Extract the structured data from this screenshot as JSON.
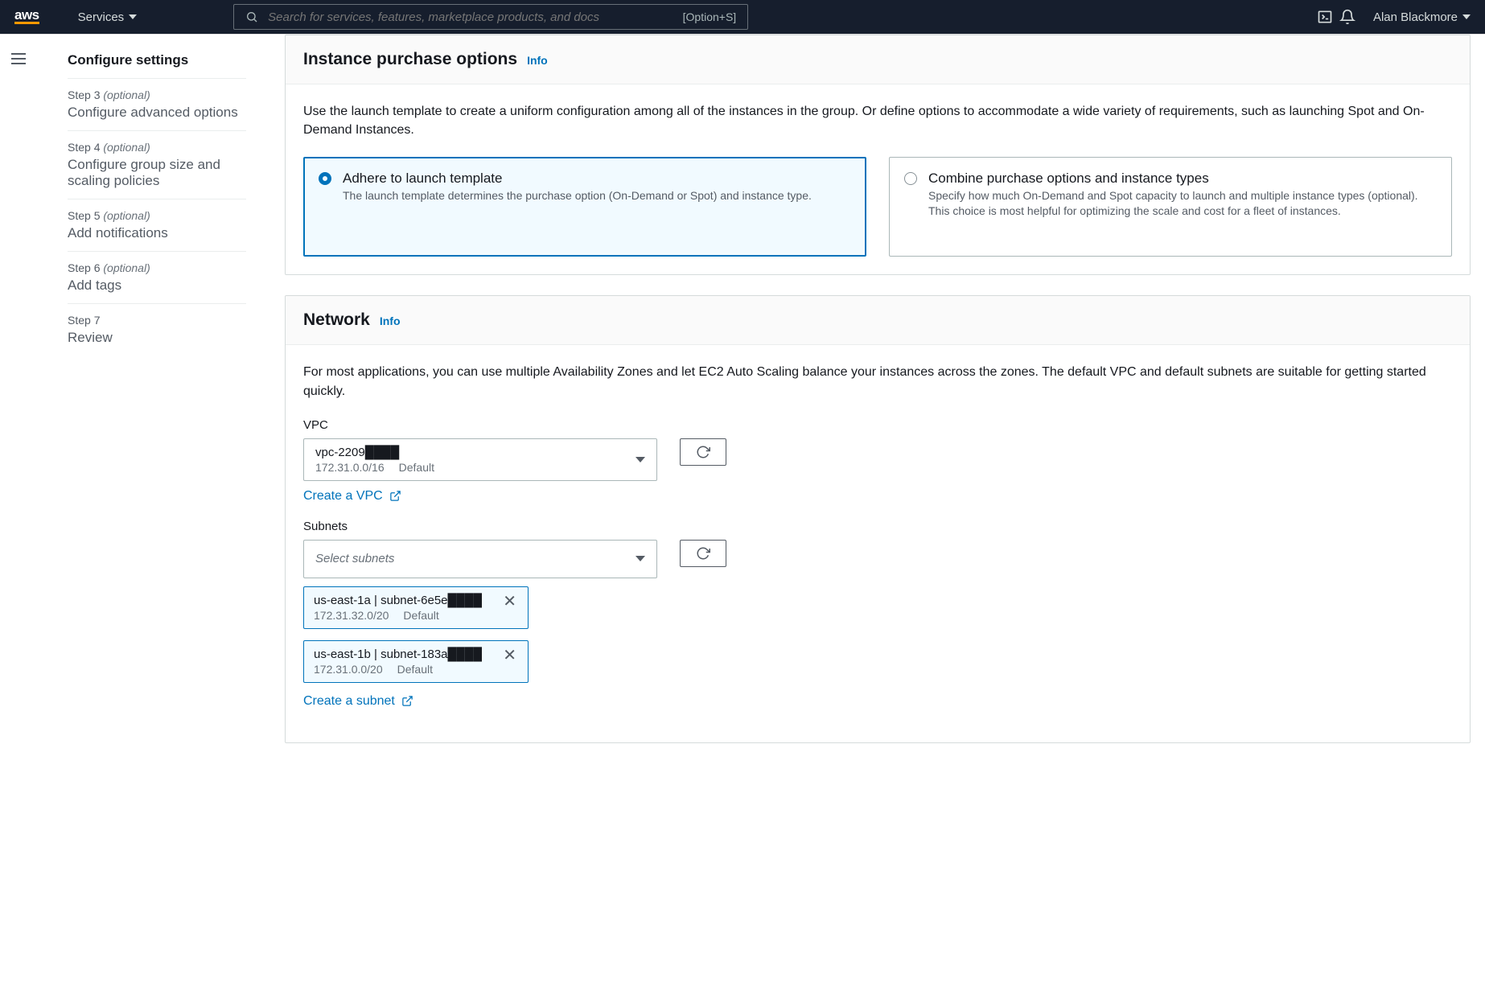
{
  "nav": {
    "logo": "aws",
    "services": "Services",
    "search_placeholder": "Search for services, features, marketplace products, and docs",
    "search_hint": "[Option+S]",
    "user": "Alan Blackmore"
  },
  "sidebar": {
    "s2": {
      "hdr": "Configure settings"
    },
    "s3": {
      "hdr": "Step 3 ",
      "opt": "(optional)",
      "title": "Configure advanced options"
    },
    "s4": {
      "hdr": "Step 4 ",
      "opt": "(optional)",
      "title": "Configure group size and scaling policies"
    },
    "s5": {
      "hdr": "Step 5 ",
      "opt": "(optional)",
      "title": "Add notifications"
    },
    "s6": {
      "hdr": "Step 6 ",
      "opt": "(optional)",
      "title": "Add tags"
    },
    "s7": {
      "hdr": "Step 7",
      "title": "Review"
    }
  },
  "purchase": {
    "heading": "Instance purchase options",
    "info": "Info",
    "desc": "Use the launch template to create a uniform configuration among all of the instances in the group. Or define options to accommodate a wide variety of requirements, such as launching Spot and On-Demand Instances.",
    "opt1_title": "Adhere to launch template",
    "opt1_desc": "The launch template determines the purchase option (On-Demand or Spot) and instance type.",
    "opt2_title": "Combine purchase options and instance types",
    "opt2_desc": "Specify how much On-Demand and Spot capacity to launch and multiple instance types (optional). This choice is most helpful for optimizing the scale and cost for a fleet of instances."
  },
  "network": {
    "heading": "Network",
    "info": "Info",
    "desc": "For most applications, you can use multiple Availability Zones and let EC2 Auto Scaling balance your instances across the zones. The default VPC and default subnets are suitable for getting started quickly.",
    "vpc_label": "VPC",
    "vpc_value": "vpc-2209████",
    "vpc_cidr": "172.31.0.0/16",
    "vpc_default": "Default",
    "create_vpc": "Create a VPC",
    "subnets_label": "Subnets",
    "subnets_placeholder": "Select subnets",
    "sub1": {
      "main": "us-east-1a | subnet-6e5e████",
      "cidr": "172.31.32.0/20",
      "def": "Default"
    },
    "sub2": {
      "main": "us-east-1b | subnet-183a████",
      "cidr": "172.31.0.0/20",
      "def": "Default"
    },
    "create_subnet": "Create a subnet"
  }
}
